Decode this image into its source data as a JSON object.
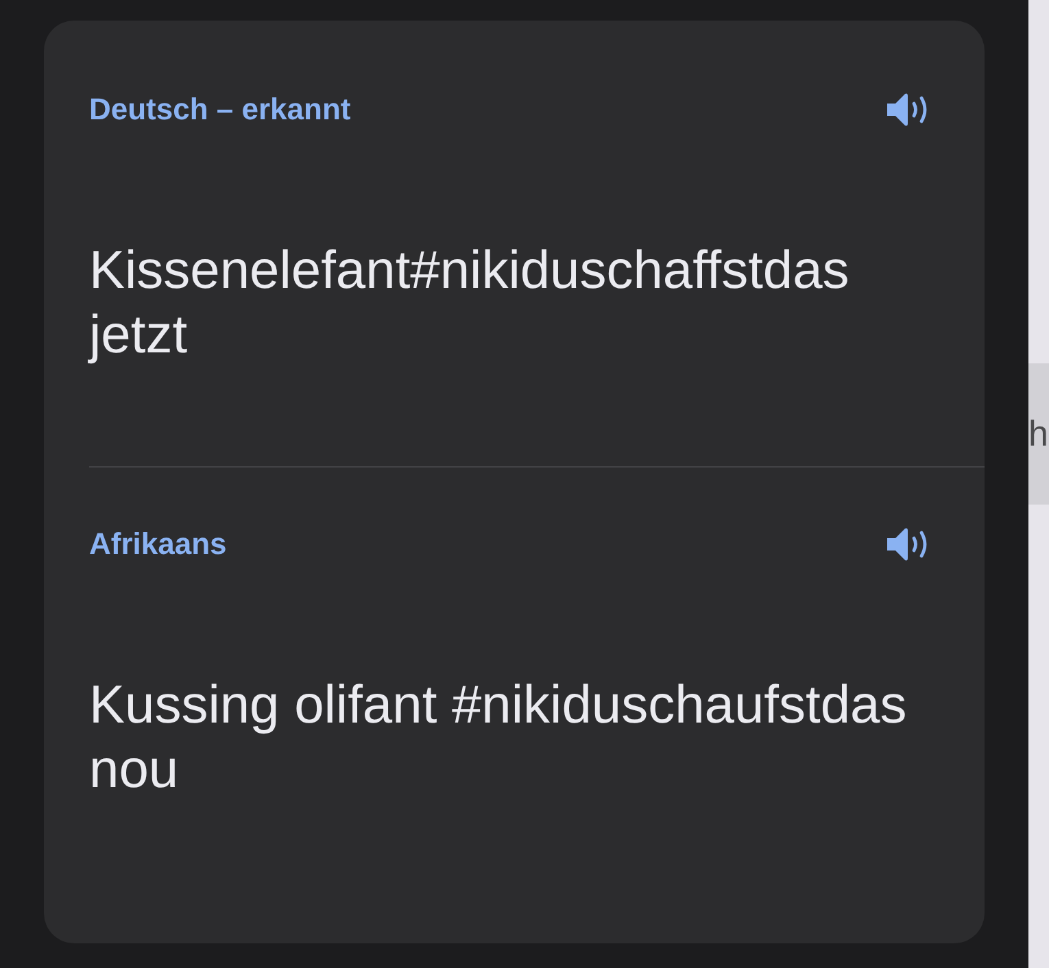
{
  "sections": [
    {
      "language": "Deutsch – erkannt",
      "text": "Kissenelefant#nikiduschaffstdas jetzt"
    },
    {
      "language": "Afrikaans",
      "text": "Kussing olifant #nikiduschaufstdas nou"
    }
  ],
  "side_panel": {
    "text": "h"
  }
}
